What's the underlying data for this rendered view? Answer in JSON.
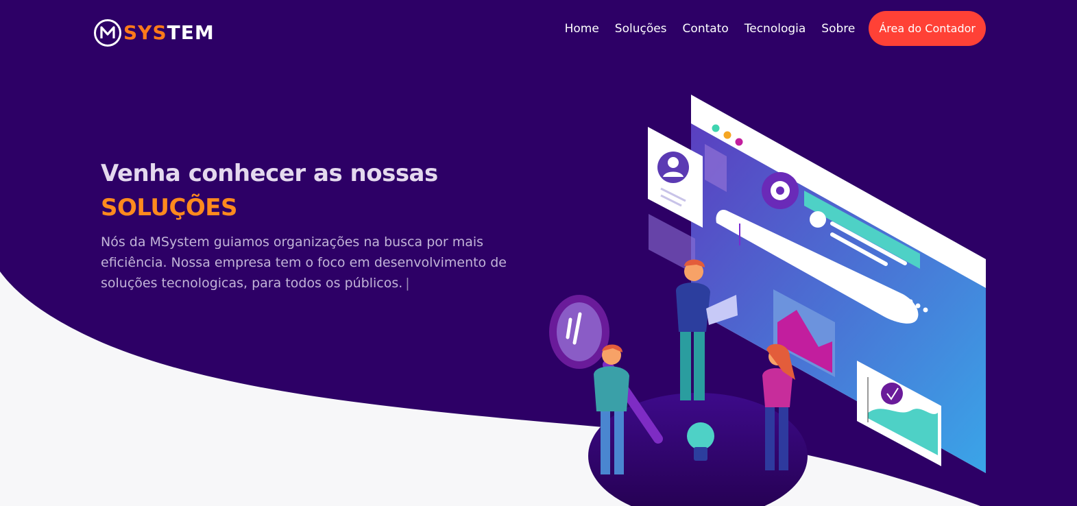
{
  "header": {
    "logo": {
      "letter": "M",
      "part1": "SYS",
      "part2": "TEM"
    },
    "nav": [
      {
        "label": "Home"
      },
      {
        "label": "Soluções"
      },
      {
        "label": "Contato"
      },
      {
        "label": "Tecnologia"
      },
      {
        "label": "Sobre"
      }
    ],
    "cta_label": "Área do Contador"
  },
  "hero": {
    "title": "Venha conhecer as nossas",
    "highlight": "SOLUÇÕES",
    "description": "Nós da MSystem guiamos organizações na busca por mais eficiência. Nossa empresa tem o foco em desenvolvimento de soluções tecnologicas, para todos os públicos.",
    "cursor": "|"
  },
  "colors": {
    "background_dark": "#2d0066",
    "background_light": "#f7f7f9",
    "accent_orange": "#ff8a1e",
    "cta_red": "#ff4136",
    "text_light": "#ffffff"
  },
  "icons": [
    "logo-m-icon",
    "user-profile-icon",
    "gear-icon",
    "magnifier-icon",
    "lightbulb-icon",
    "image-icon",
    "chart-icon",
    "star-rating-icon"
  ]
}
